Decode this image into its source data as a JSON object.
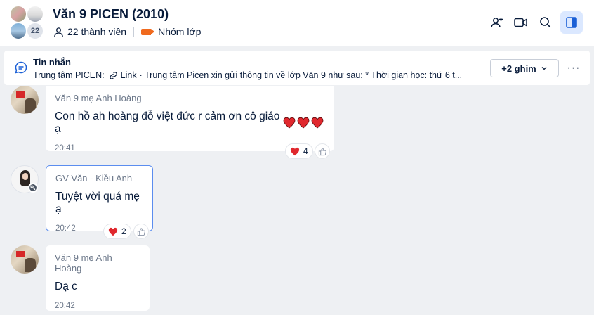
{
  "header": {
    "title": "Văn 9 PICEN (2010)",
    "members_text": "22 thành viên",
    "group_type": "Nhóm lớp",
    "member_count_badge": "22"
  },
  "pinned": {
    "title": "Tin nhắn",
    "sender": "Trung tâm PICEN:",
    "link_label": "Link",
    "preview": "· Trung tâm Picen xin gửi thông tin về lớp Văn 9 như sau:  * Thời gian học: thứ 6 t...",
    "pin_button": "+2 ghim",
    "more": "···"
  },
  "messages": [
    {
      "sender": "Văn 9 mẹ Anh Hoàng",
      "text": "Con hồ ah hoàng đỗ việt đức r cảm ơn cô giáo ạ",
      "emoji_hearts": 3,
      "time": "20:41",
      "reaction_count": "4"
    },
    {
      "sender": "GV Văn - Kiều Anh",
      "text": "Tuyệt vời quá mẹ ạ",
      "time": "20:42",
      "reaction_count": "2"
    },
    {
      "sender": "Văn 9 mẹ Anh Hoàng",
      "text": "Dạ c",
      "time": "20:42"
    }
  ],
  "colors": {
    "accent": "#1a5fd6",
    "tag": "#f06a1e",
    "heart": "#e0282e",
    "background": "#eef0f3"
  },
  "icons": [
    "user-icon",
    "tag-icon",
    "add-member-icon",
    "video-call-icon",
    "search-icon",
    "sidebar-toggle-icon",
    "chat-bubble-icon",
    "link-icon",
    "chevron-down-icon",
    "heart-icon",
    "thumbs-up-icon",
    "key-icon"
  ]
}
